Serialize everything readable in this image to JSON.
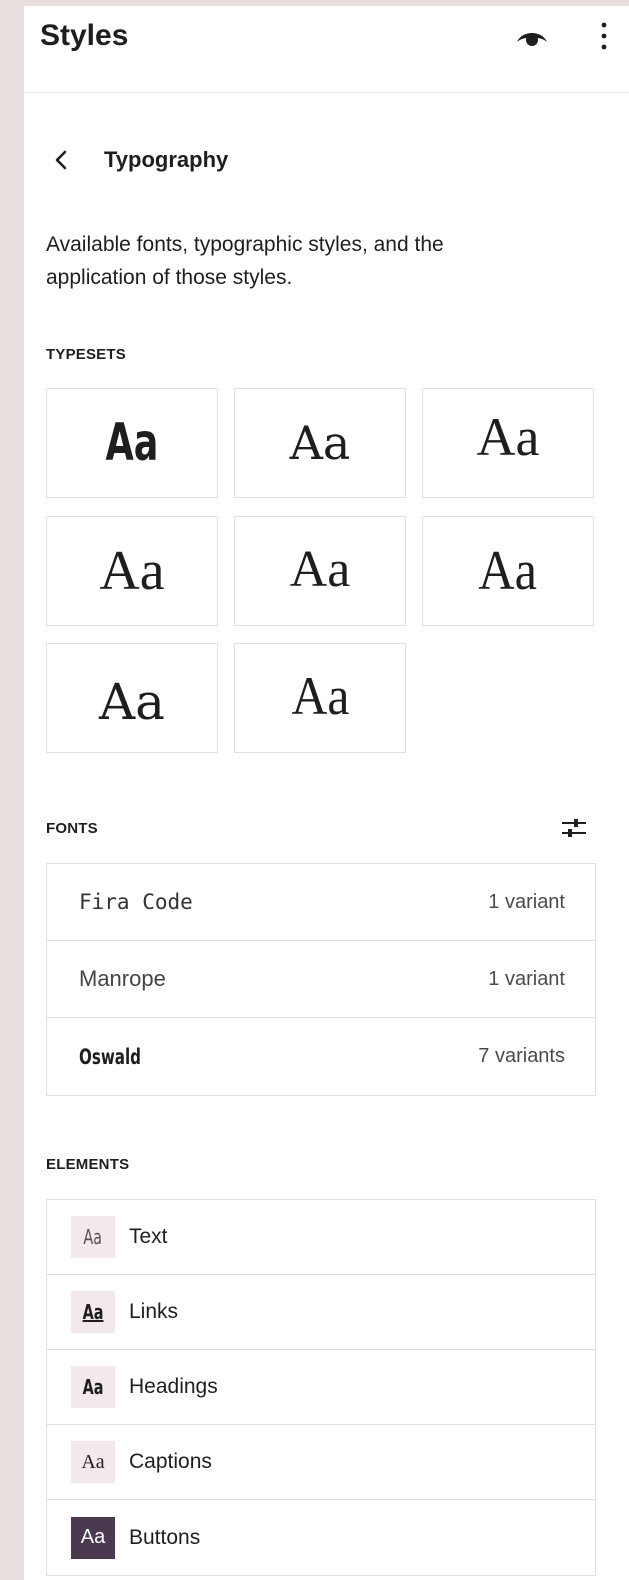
{
  "header": {
    "title": "Styles",
    "preview_icon": "eye-icon",
    "more_icon": "more-vertical-icon"
  },
  "nav": {
    "back_icon": "chevron-left-icon",
    "title": "Typography"
  },
  "description": "Available fonts, typographic styles, and the application of those styles.",
  "typesets": {
    "label": "TYPESETS",
    "items": [
      "Aa",
      "Aa",
      "Aa",
      "Aa",
      "Aa",
      "Aa",
      "Aa",
      "Aa"
    ]
  },
  "fonts": {
    "label": "FONTS",
    "adjust_icon": "sliders-icon",
    "items": [
      {
        "name": "Fira Code",
        "count": "1 variant"
      },
      {
        "name": "Manrope",
        "count": "1 variant"
      },
      {
        "name": "Oswald",
        "count": "7 variants"
      }
    ]
  },
  "elements": {
    "label": "ELEMENTS",
    "items": [
      {
        "icon": "Aa",
        "label": "Text"
      },
      {
        "icon": "Aa",
        "label": "Links"
      },
      {
        "icon": "Aa",
        "label": "Headings"
      },
      {
        "icon": "Aa",
        "label": "Captions"
      },
      {
        "icon": "Aa",
        "label": "Buttons"
      }
    ]
  },
  "colors": {
    "panel_bg": "#ffffff",
    "page_bg": "#e9dfdf",
    "icon_tile_bg": "#f4e9ea",
    "button_tile_bg": "#4b3a4f",
    "border": "#e0e0e0",
    "text": "#1e1e1e"
  }
}
